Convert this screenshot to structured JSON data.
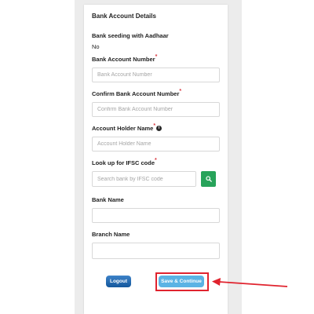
{
  "card": {
    "title": "Bank Account Details"
  },
  "seeding": {
    "label": "Bank seeding with Aadhaar",
    "value": "No"
  },
  "account_number": {
    "label": "Bank Account Number",
    "required": "*",
    "placeholder": "Bank Account Number"
  },
  "confirm_account": {
    "label": "Confirm Bank Account Number",
    "required": "*",
    "placeholder": "Confirm Bank Account Number"
  },
  "holder_name": {
    "label": "Account Holder Name",
    "required": "*",
    "info_icon": "i",
    "placeholder": "Account Holder Name"
  },
  "ifsc": {
    "label": "Look up for IFSC code",
    "required": "*",
    "placeholder": "Search bank by IFSC code"
  },
  "bank_name": {
    "label": "Bank Name",
    "value": ""
  },
  "branch_name": {
    "label": "Branch Name",
    "value": ""
  },
  "actions": {
    "logout_label": "Logout",
    "save_label": "Save & Continue"
  },
  "colors": {
    "highlight": "#e0232e",
    "search_button": "#27a35a",
    "save_button": "#5bb3e4",
    "logout_button": "#1f6bb5",
    "required_marker": "#d9363e"
  },
  "icons": {
    "search_button": "search-icon",
    "holder_info": "info-icon",
    "annotation": "arrow-icon"
  }
}
